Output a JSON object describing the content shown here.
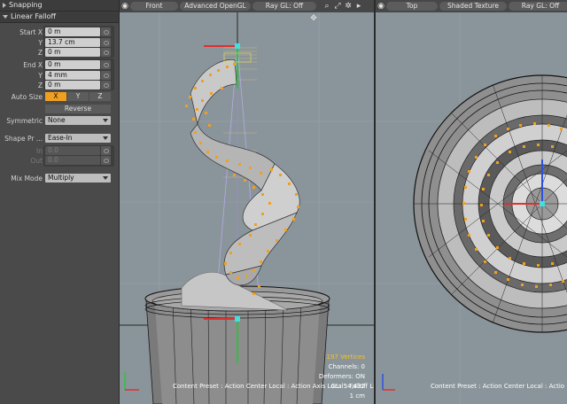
{
  "panel": {
    "snapping_title": "Snapping",
    "falloff_title": "Linear Falloff",
    "start": {
      "x_label": "Start X",
      "x_value": "0 m",
      "y_label": "Y",
      "y_value": "13.7 cm",
      "z_label": "Z",
      "z_value": "0 m"
    },
    "end": {
      "x_label": "End X",
      "x_value": "0 m",
      "y_label": "Y",
      "y_value": "4 mm",
      "z_label": "Z",
      "z_value": "0 m"
    },
    "auto_size_label": "Auto Size",
    "auto_size_options": [
      "X",
      "Y",
      "Z"
    ],
    "auto_size_selected": "X",
    "reverse_label": "Reverse",
    "symmetric_label": "Symmetric",
    "symmetric_value": "None",
    "shape_label": "Shape Pr ...",
    "shape_value": "Ease-In",
    "in_label": "In",
    "in_value": "0.0",
    "out_label": "Out",
    "out_value": "0.0",
    "mix_label": "Mix Mode",
    "mix_value": "Multiply"
  },
  "viewport_front": {
    "view_label": "Front",
    "render_label": "Advanced OpenGL",
    "raygl_label": "Ray GL: Off",
    "icons": [
      "search-icon",
      "fit-icon",
      "settings-icon",
      "more-arrow-icon"
    ],
    "stats": {
      "vertices": "197 Vertices",
      "channels": "Channels: 0",
      "deformers": "Deformers: ON",
      "gl": "GL: 54,432",
      "scale": "1 cm",
      "footer": "Content Preset : Action Center Local : Action Axis Local : Falloff Linear"
    }
  },
  "viewport_top": {
    "view_label": "Top",
    "render_label": "Shaded Texture",
    "raygl_label": "Ray GL: Off",
    "footer": "Content Preset : Action Center Local : Actio"
  },
  "colors": {
    "panel_bg": "#4a4a4a",
    "viewport_bg": "#8a959b",
    "selection_orange": "#f0a020",
    "axis_red": "#e03030",
    "axis_green": "#30c040",
    "axis_blue": "#3050e0",
    "handle_cyan": "#40e0e0",
    "stat_yellow": "#f3c02b"
  }
}
